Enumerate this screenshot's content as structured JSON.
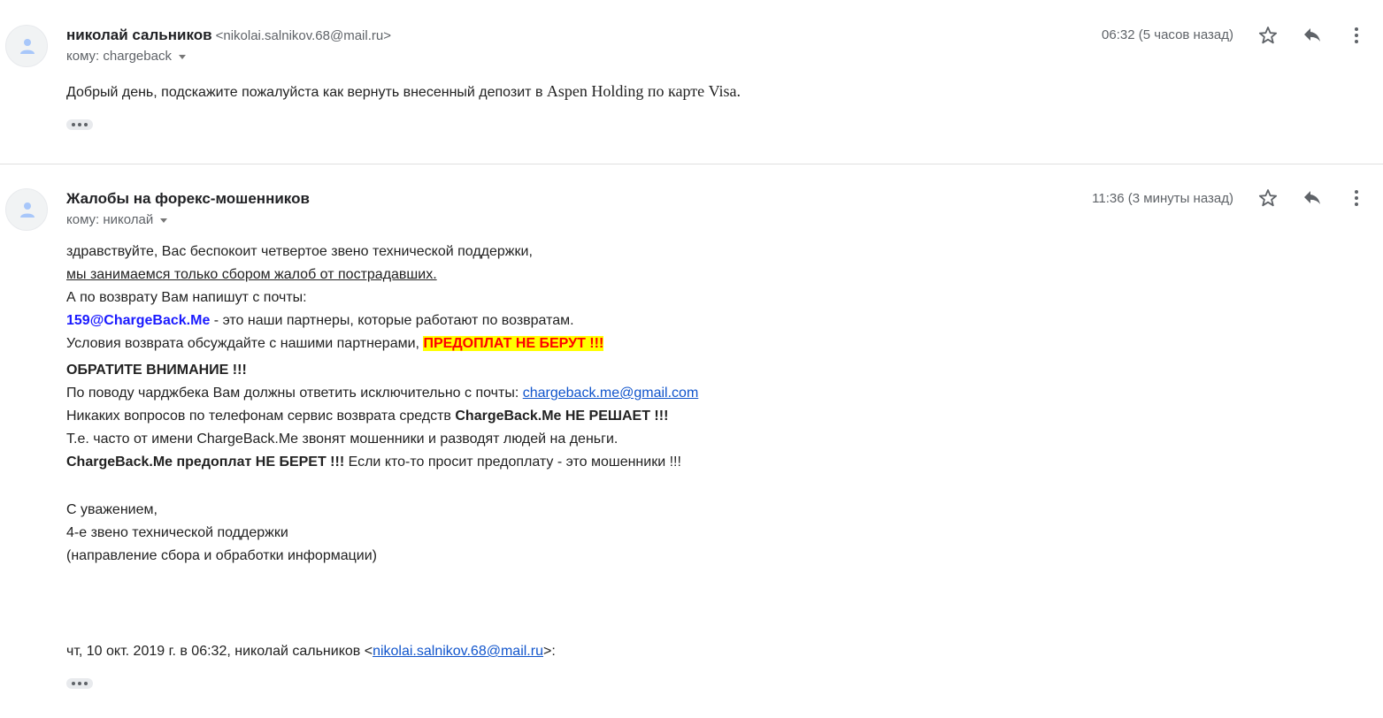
{
  "message1": {
    "sender_name": "николай сальников",
    "sender_email": "<nikolai.salnikov.68@mail.ru>",
    "to_label": "кому: chargeback",
    "time": "06:32 (5 часов назад)",
    "body_prefix": "Добрый день, подскажите пожалуйста как вернуть внесенный депозит в ",
    "body_serif": "Aspen Holding по карте Visa."
  },
  "message2": {
    "sender_name": "Жалобы на форекс-мошенников",
    "to_label": "кому: николай",
    "time": "11:36 (3 минуты назад)",
    "line1": "здравствуйте, Вас беспокоит четвертое звено технической поддержки,",
    "line2": "мы занимаемся только сбором жалоб от пострадавших.",
    "line3": "А по возврату Вам напишут с почты:",
    "line4_email": "159@ChargeBack.Me",
    "line4_rest": " - это наши партнеры, которые работают по возвратам.",
    "line5_text": "Условия возврата обсуждайте с нашими партнерами, ",
    "line5_highlight": "ПРЕДОПЛАТ НЕ БЕРУТ !!!",
    "line6": "ОБРАТИТЕ ВНИМАНИЕ !!!",
    "line7_text": "По поводу чарджбека Вам должны ответить исключительно с почты: ",
    "line7_link": "chargeback.me@gmail.com",
    "line8_text": "Никаких вопросов по телефонам сервис возврата средств ",
    "line8_bold": "ChargeBack.Me НЕ РЕШАЕТ !!!",
    "line9": "Т.е. часто от имени ChargeBack.Me звонят мошенники и разводят людей на деньги.",
    "line10_bold": "ChargeBack.Me предоплат НЕ БЕРЕТ !!!",
    "line10_rest": " Если кто-то просит предоплату - это мошенники !!!",
    "sig1": "С уважением,",
    "sig2": "4-е звено технической поддержки",
    "sig3": "(направление сбора и обработки информации)",
    "quote_prefix": "чт, 10 окт. 2019 г. в 06:32, николай сальников <",
    "quote_link": "nikolai.salnikov.68@mail.ru",
    "quote_suffix": ">:"
  },
  "icons": {
    "star": "star-icon",
    "reply": "reply-icon",
    "more": "more-vert-icon",
    "avatar": "person-icon"
  },
  "colors": {
    "link": "#1155cc",
    "email_blue": "#1a1aff",
    "highlight_bg": "#ffff00",
    "highlight_text": "#ff0000"
  }
}
